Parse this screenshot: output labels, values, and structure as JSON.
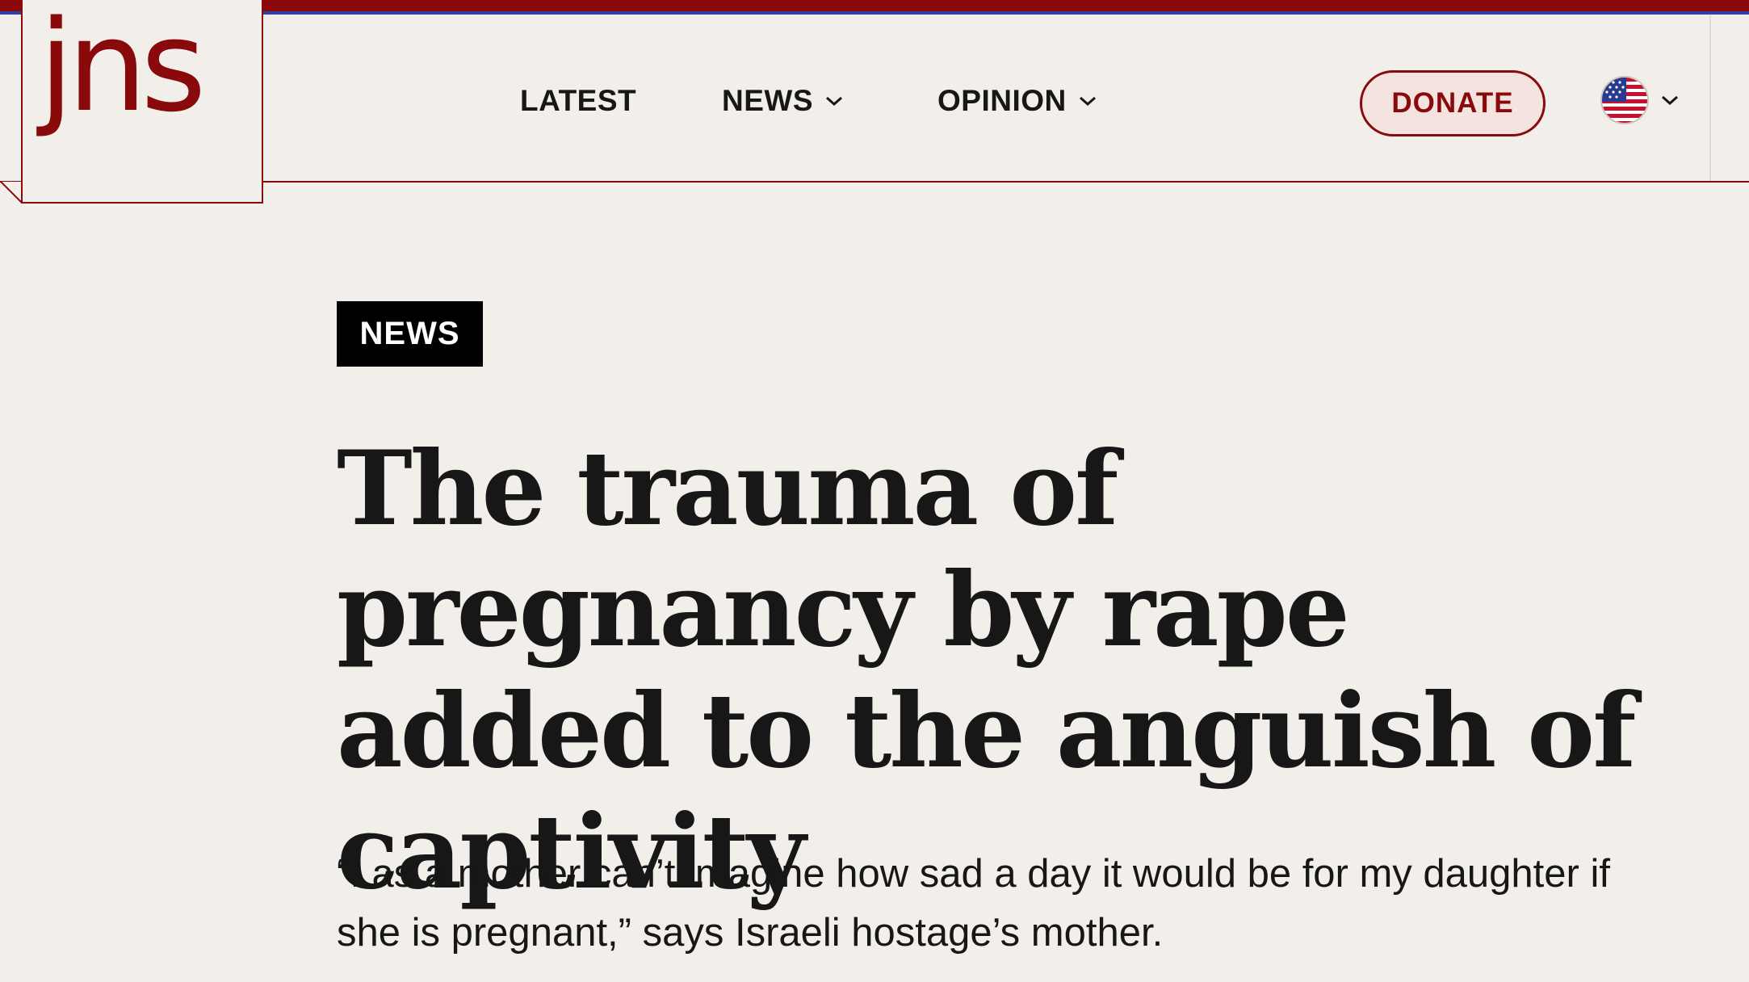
{
  "colors": {
    "brand": "#8a0a0c",
    "accent_line": "#2f3fa6",
    "background": "#f2efea",
    "tag_background": "#000000",
    "text": "#171717"
  },
  "header": {
    "logo_text": "jns",
    "nav": [
      {
        "label": "LATEST",
        "has_dropdown": false
      },
      {
        "label": "NEWS",
        "has_dropdown": true
      },
      {
        "label": "OPINION",
        "has_dropdown": true
      }
    ],
    "donate_label": "DONATE",
    "language": {
      "icon": "us-flag-icon",
      "has_dropdown": true
    }
  },
  "article": {
    "category": "NEWS",
    "headline": "The trauma of pregnancy by rape added to the anguish of captivity",
    "dek": "“I as a mother can’t imagine how sad a day it would be for my daughter if she is pregnant,” says Israeli hostage’s mother."
  }
}
